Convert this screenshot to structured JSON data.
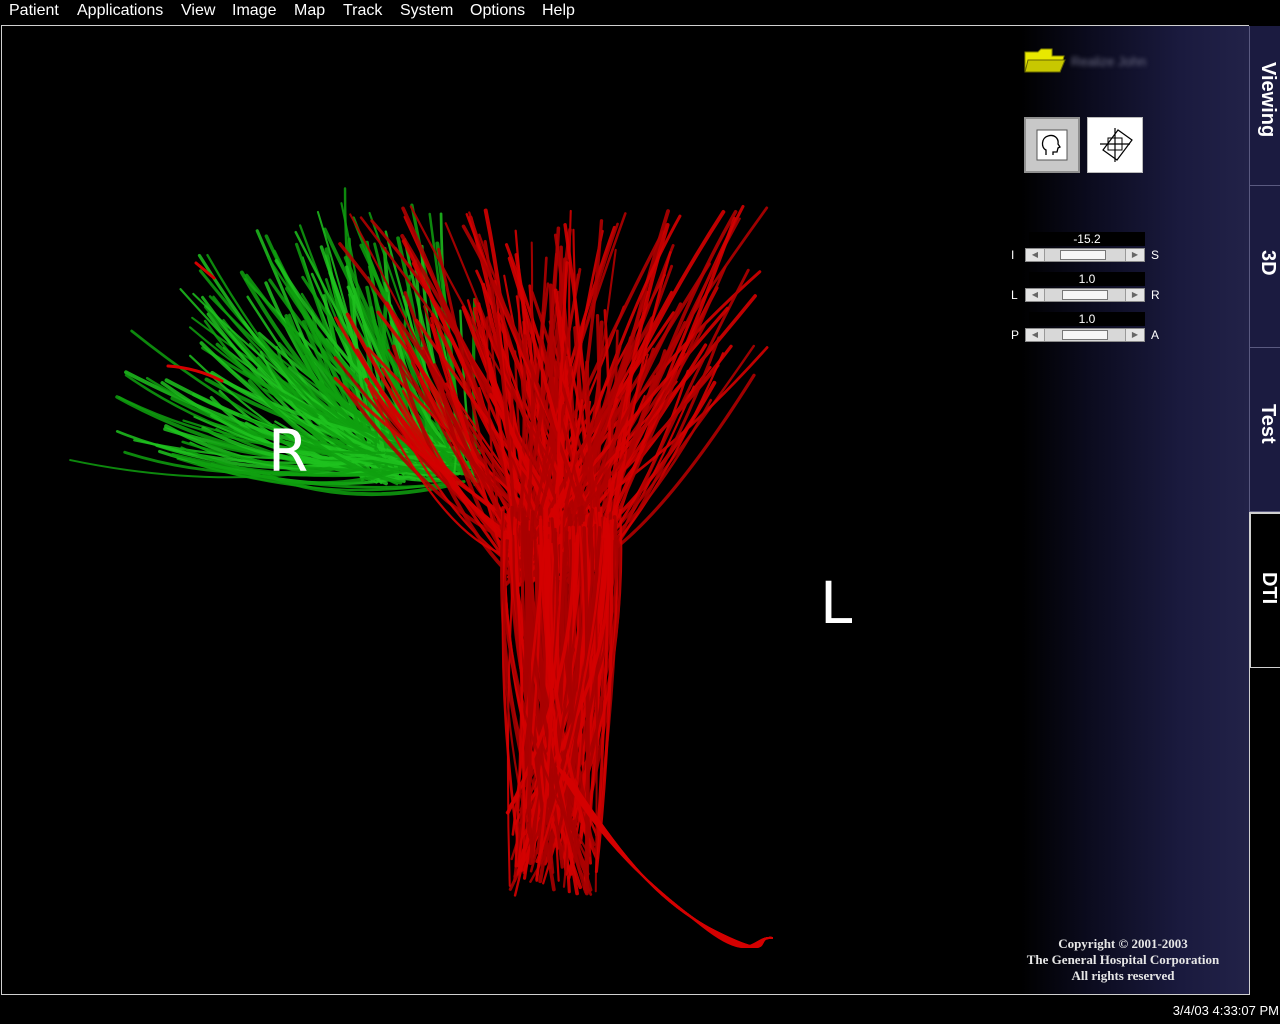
{
  "menu": [
    "Patient",
    "Applications",
    "View",
    "Image",
    "Map",
    "Track",
    "System",
    "Options",
    "Help"
  ],
  "viewport": {
    "orientation_right": "R",
    "orientation_left": "L",
    "fiber_colors": {
      "green": "#1ec21e",
      "red": "#d40000"
    }
  },
  "panel": {
    "patient_name": "Realize John",
    "folder_icon": "folder-icon",
    "sliders": [
      {
        "value": "-15.2",
        "min_label": "I",
        "max_label": "S",
        "level": 0.45
      },
      {
        "value": "1.0",
        "min_label": "L",
        "max_label": "R",
        "level": 0.5
      },
      {
        "value": "1.0",
        "min_label": "P",
        "max_label": "A",
        "level": 0.5
      }
    ],
    "copyright": [
      "Copyright © 2001-2003",
      "The General Hospital Corporation",
      "All rights reserved"
    ]
  },
  "tabs": [
    {
      "label": "Viewing",
      "active": false
    },
    {
      "label": "3D",
      "active": false
    },
    {
      "label": "Test",
      "active": false
    },
    {
      "label": "DTI",
      "active": true
    }
  ],
  "status": {
    "datetime": "3/4/03 4:33:07 PM"
  },
  "colors": {
    "panel_accent": "#222248",
    "background": "#000000"
  }
}
